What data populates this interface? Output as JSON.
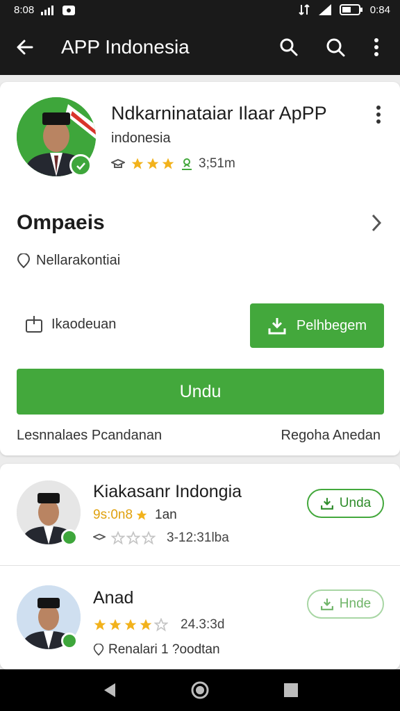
{
  "status_bar": {
    "left_text": "8:08",
    "time": "0:84"
  },
  "app_bar": {
    "title": "APP Indonesia"
  },
  "main_app": {
    "title": "Ndkarninataiar Ilaar ApPP",
    "subtitle": "indonesia",
    "rating_stars": 3,
    "downloads": "3;51m",
    "section_title": "Ompaeis",
    "info_text": "Nellarakontiai",
    "secondary_label": "Ikaodeuan",
    "action_button": "Pelhbegem",
    "download_button": "Undu",
    "footer_left": "Lesnnalaes Pcandanan",
    "footer_right": "Regoha Anedan"
  },
  "list": [
    {
      "title": "Kiakasanr Indongia",
      "highlight": "9s:0n8",
      "highlight_suffix": "1an",
      "stars": 0,
      "meta": "3-12:31lba",
      "button": "Unda"
    },
    {
      "title": "Anad",
      "stars": 4,
      "meta": "24.3:3d",
      "location": "Renalari 1 ?oodtan",
      "button": "Hnde"
    }
  ],
  "colors": {
    "accent": "#43a83c",
    "star": "#f2b21c",
    "bar": "#1a1a1a"
  }
}
